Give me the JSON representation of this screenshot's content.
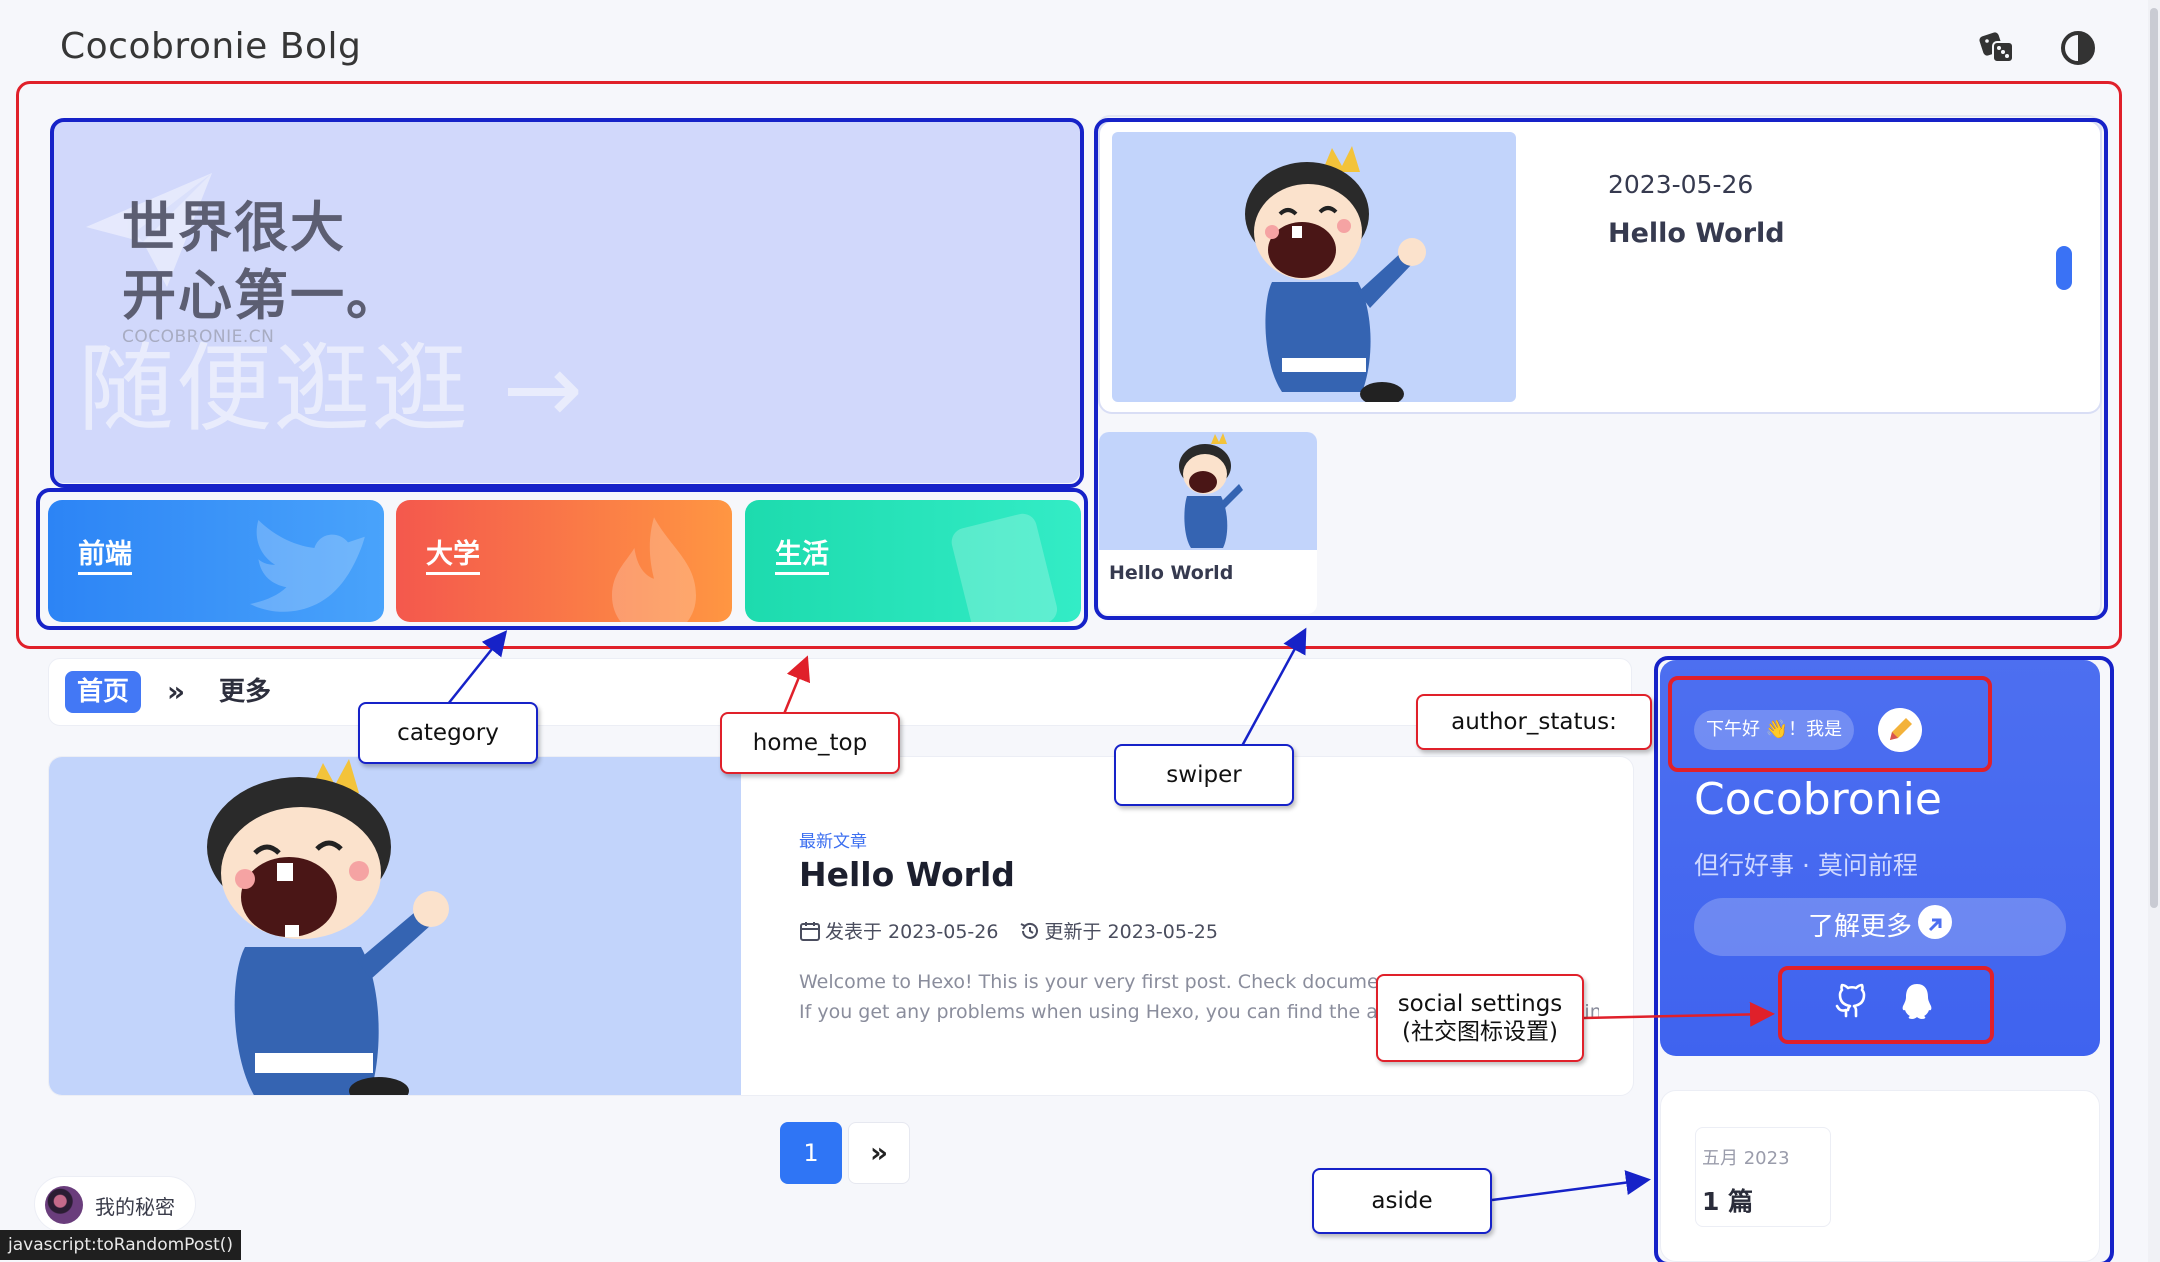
{
  "header": {
    "site_title": "Cocobronie Bolg",
    "dice_icon": "dice-icon",
    "theme_icon": "contrast-icon"
  },
  "banner": {
    "line1": "世界很大",
    "line2": "开心第一。",
    "url": "COCOBRONIE.CN",
    "cta": "随便逛逛 →"
  },
  "categories": [
    {
      "label": "前端",
      "icon": "bird-icon",
      "color_from": "#2c84f5",
      "color_to": "#49a3fb"
    },
    {
      "label": "大学",
      "icon": "flame-icon",
      "color_from": "#f4584d",
      "color_to": "#ff9642"
    },
    {
      "label": "生活",
      "icon": "document-icon",
      "color_from": "#1ddbae",
      "color_to": "#33ecc6"
    }
  ],
  "swiper": {
    "main": {
      "date": "2023-05-26",
      "title": "Hello World"
    },
    "thumb": {
      "title": "Hello World"
    }
  },
  "breadcrumb": {
    "home": "首页",
    "separator": "»",
    "more": "更多"
  },
  "post": {
    "tag": "最新文章",
    "title": "Hello World",
    "published": "发表于 2023-05-26",
    "updated": "更新于 2023-05-25",
    "excerpt_line1": "Welcome to Hexo! This is your very first post. Check documentation for more info.",
    "excerpt_line2": "If you get any problems when using Hexo, you can find the answer in troubleshooting."
  },
  "pagination": {
    "current": "1",
    "next": "»"
  },
  "secret": {
    "label": "我的秘密"
  },
  "statusbar": {
    "text": "javascript:toRandomPost()"
  },
  "author": {
    "greeting": "下午好 👋！我是",
    "name": "Cocobronie",
    "description": "但行好事 · 莫问前程",
    "learn_more": "了解更多",
    "social": [
      "github-icon",
      "qq-icon"
    ]
  },
  "archive": {
    "month": "五月 2023",
    "count": "1 篇"
  },
  "annotations": {
    "category": "category",
    "home_top": "home_top",
    "swiper": "swiper",
    "author_status": "author_status:",
    "social_line1": "social settings",
    "social_line2": "(社交图标设置)",
    "aside": "aside"
  },
  "colors": {
    "accent": "#3a72f5",
    "annotation_red": "#e0202a",
    "annotation_blue": "#1622c8",
    "author_card": "#4d6ff0"
  }
}
